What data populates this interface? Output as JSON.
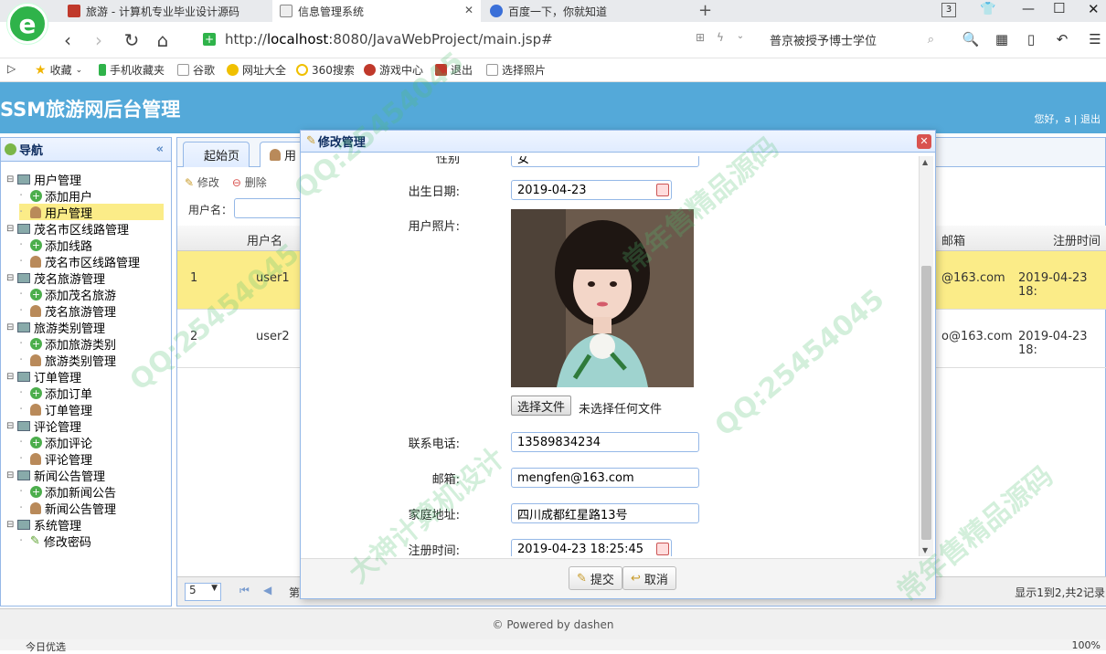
{
  "browser": {
    "tabs": [
      {
        "label": "旅游 - 计算机专业毕业设计源码"
      },
      {
        "label": "信息管理系统"
      },
      {
        "label": "百度一下，你就知道"
      }
    ],
    "new_tab_symbol": "+",
    "tab_count": "3",
    "url_prefix": "http://",
    "url_host": "localhost",
    "url_rest": ":8080/JavaWebProject/main.jsp#",
    "search_text": "普京被授予博士学位",
    "bookmarks": [
      "收藏",
      "手机收藏夹",
      "谷歌",
      "网址大全",
      "360搜索",
      "游戏中心",
      "退出",
      "选择照片"
    ]
  },
  "app": {
    "title": "SSM旅游网后台管理",
    "user_greeting": "您好，a",
    "logout": "退出"
  },
  "nav": {
    "title": "导航",
    "groups": [
      {
        "label": "用户管理",
        "items": [
          {
            "label": "添加用户"
          },
          {
            "label": "用户管理"
          }
        ]
      },
      {
        "label": "茂名市区线路管理",
        "items": [
          {
            "label": "添加线路"
          },
          {
            "label": "茂名市区线路管理"
          }
        ]
      },
      {
        "label": "茂名旅游管理",
        "items": [
          {
            "label": "添加茂名旅游"
          },
          {
            "label": "茂名旅游管理"
          }
        ]
      },
      {
        "label": "旅游类别管理",
        "items": [
          {
            "label": "添加旅游类别"
          },
          {
            "label": "旅游类别管理"
          }
        ]
      },
      {
        "label": "订单管理",
        "items": [
          {
            "label": "添加订单"
          },
          {
            "label": "订单管理"
          }
        ]
      },
      {
        "label": "评论管理",
        "items": [
          {
            "label": "添加评论"
          },
          {
            "label": "评论管理"
          }
        ]
      },
      {
        "label": "新闻公告管理",
        "items": [
          {
            "label": "添加新闻公告"
          },
          {
            "label": "新闻公告管理"
          }
        ]
      },
      {
        "label": "系统管理",
        "items": [
          {
            "label": "修改密码"
          }
        ]
      }
    ]
  },
  "main": {
    "tabs": [
      {
        "label": "起始页"
      },
      {
        "label": "用"
      }
    ],
    "toolbar": {
      "edit": "修改",
      "delete": "删除",
      "search_label": "用户名："
    },
    "columns": {
      "username": "用户名",
      "email": "邮箱",
      "regtime": "注册时间"
    },
    "rows": [
      {
        "idx": "1",
        "username": "user1",
        "email": "@163.com",
        "regtime": "2019-04-23 18:"
      },
      {
        "idx": "2",
        "username": "user2",
        "email": "o@163.com",
        "regtime": "2019-04-23 18:"
      }
    ],
    "pager": {
      "page_size": "5",
      "first_char": "第",
      "summary": "显示1到2,共2记录"
    }
  },
  "dialog": {
    "title": "修改管理",
    "partial_label": "性别",
    "partial_value": "女",
    "fields": {
      "birthday_label": "出生日期:",
      "birthday": "2019-04-23",
      "photo_label": "用户照片:",
      "choose_file": "选择文件",
      "no_file": "未选择任何文件",
      "phone_label": "联系电话:",
      "phone": "13589834234",
      "email_label": "邮箱:",
      "email": "mengfen@163.com",
      "address_label": "家庭地址:",
      "address": "四川成都红星路13号",
      "regtime_label": "注册时间:",
      "regtime": "2019-04-23 18:25:45"
    },
    "submit": "提交",
    "cancel": "取消"
  },
  "footer": {
    "text": "© Powered by dashen"
  },
  "statusbar": {
    "left": "今日优选",
    "zoom": "100%"
  },
  "watermark": {
    "qq": "QQ:25454045",
    "brand": "大神计算机设计",
    "brand2": "常年售精品源码"
  }
}
